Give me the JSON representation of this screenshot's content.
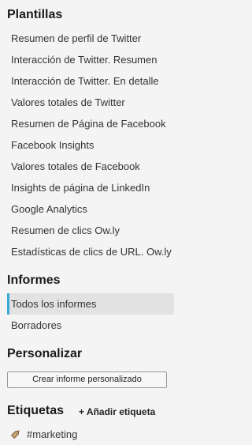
{
  "plantillas": {
    "title": "Plantillas",
    "items": [
      "Resumen de perfil de Twitter",
      "Interacción de Twitter. Resumen",
      "Interacción de Twitter. En detalle",
      "Valores totales de Twitter",
      "Resumen de Página de Facebook",
      "Facebook Insights",
      "Valores totales de Facebook",
      "Insights de página de LinkedIn",
      "Google Analytics",
      "Resumen de clics Ow.ly",
      "Estadísticas de clics de URL. Ow.ly"
    ]
  },
  "informes": {
    "title": "Informes",
    "items": [
      "Todos los informes",
      "Borradores"
    ]
  },
  "personalizar": {
    "title": "Personalizar",
    "button_label": "Crear informe personalizado"
  },
  "etiquetas": {
    "title": "Etiquetas",
    "add_label": "+ Añadir etiqueta",
    "tags": [
      "#marketing"
    ]
  },
  "colors": {
    "active_accent": "#3fa7d6",
    "active_bg": "#e2e2e2",
    "background": "#f4f4f4",
    "tag_icon": "#8a6d4a"
  },
  "icons": {
    "tag": "tag-icon"
  }
}
